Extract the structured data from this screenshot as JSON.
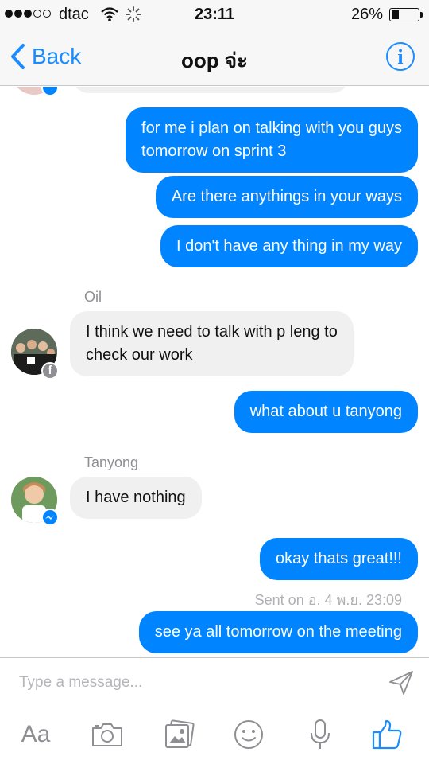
{
  "status_bar": {
    "carrier": "dtac",
    "time": "23:11",
    "battery_percent": "26%",
    "battery_level": 0.26
  },
  "nav": {
    "back_label": "Back",
    "title": "oop จ่ะ",
    "info_label": "i"
  },
  "messages": [
    {
      "type": "outgoing",
      "text_lines": [
        "for me i plan on talking with you guys",
        "tomorrow on sprint 3"
      ]
    },
    {
      "type": "outgoing",
      "text": "Are there anythings in your ways"
    },
    {
      "type": "outgoing",
      "text": "I don't have any thing in my way"
    },
    {
      "type": "incoming",
      "sender": "Oil",
      "text_lines": [
        "I think we need to talk with p leng to",
        "check our work"
      ],
      "badge": "facebook"
    },
    {
      "type": "outgoing",
      "text": "what about u tanyong"
    },
    {
      "type": "incoming",
      "sender": "Tanyong",
      "text": "I have nothing",
      "badge": "messenger"
    },
    {
      "type": "outgoing",
      "text": "okay thats great!!!"
    },
    {
      "type": "status",
      "text": "Sent on อ. 4 พ.ย. 23:09"
    },
    {
      "type": "outgoing",
      "text": "see ya all tomorrow on the meeting"
    }
  ],
  "composer": {
    "placeholder": "Type a message...",
    "toolbar": [
      {
        "name": "text-format",
        "label": "Aa"
      },
      {
        "name": "camera-icon"
      },
      {
        "name": "photo-gallery-icon"
      },
      {
        "name": "emoji-icon"
      },
      {
        "name": "microphone-icon"
      },
      {
        "name": "thumbs-up-icon"
      }
    ]
  },
  "colors": {
    "accent": "#1a8cff",
    "outgoing_bubble": "#0084ff",
    "incoming_bubble": "#f1f0f0",
    "gray_text": "#8e8e93"
  }
}
